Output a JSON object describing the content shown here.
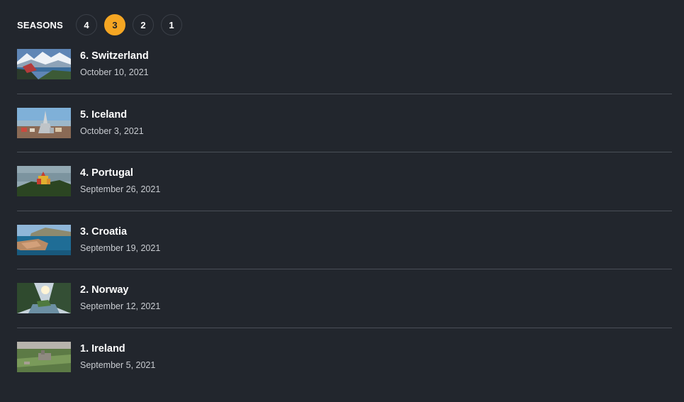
{
  "seasons": {
    "label": "SEASONS",
    "items": [
      "4",
      "3",
      "2",
      "1"
    ],
    "active": "3"
  },
  "episodes": [
    {
      "title": "6. Switzerland",
      "date": "October 10, 2021",
      "thumb": "mountain-lake-thumbnail"
    },
    {
      "title": "5. Iceland",
      "date": "October 3, 2021",
      "thumb": "church-town-thumbnail"
    },
    {
      "title": "4. Portugal",
      "date": "September 26, 2021",
      "thumb": "palace-hill-thumbnail"
    },
    {
      "title": "3. Croatia",
      "date": "September 19, 2021",
      "thumb": "coastal-town-thumbnail"
    },
    {
      "title": "2. Norway",
      "date": "September 12, 2021",
      "thumb": "fjord-valley-thumbnail"
    },
    {
      "title": "1. Ireland",
      "date": "September 5, 2021",
      "thumb": "castle-field-thumbnail"
    }
  ],
  "colors": {
    "background": "#22262d",
    "accent": "#f5a623",
    "divider": "#4a4f57"
  }
}
